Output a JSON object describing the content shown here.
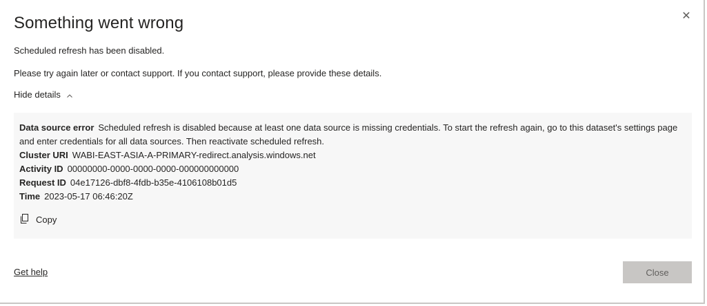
{
  "dialog": {
    "title": "Something went wrong",
    "message": "Scheduled refresh has been disabled.",
    "support_text": "Please try again later or contact support. If you contact support, please provide these details.",
    "toggle_label": "Hide details",
    "close_icon": "close-icon"
  },
  "details": {
    "data_source_error_label": "Data source error",
    "data_source_error_value": "Scheduled refresh is disabled because at least one data source is missing credentials. To start the refresh again, go to this dataset's settings page and enter credentials for all data sources. Then reactivate scheduled refresh.",
    "cluster_uri_label": "Cluster URI",
    "cluster_uri_value": "WABI-EAST-ASIA-A-PRIMARY-redirect.analysis.windows.net",
    "activity_id_label": "Activity ID",
    "activity_id_value": "00000000-0000-0000-0000-000000000000",
    "request_id_label": "Request ID",
    "request_id_value": "04e17126-dbf8-4fdb-b35e-4106108b01d5",
    "time_label": "Time",
    "time_value": "2023-05-17 06:46:20Z",
    "copy_label": "Copy",
    "copy_icon": "copy-icon"
  },
  "footer": {
    "get_help_label": "Get help",
    "close_label": "Close"
  },
  "colors": {
    "details_bg": "#f7f7f7",
    "close_button_bg": "#c8c6c4",
    "close_button_text": "#605e5c"
  }
}
